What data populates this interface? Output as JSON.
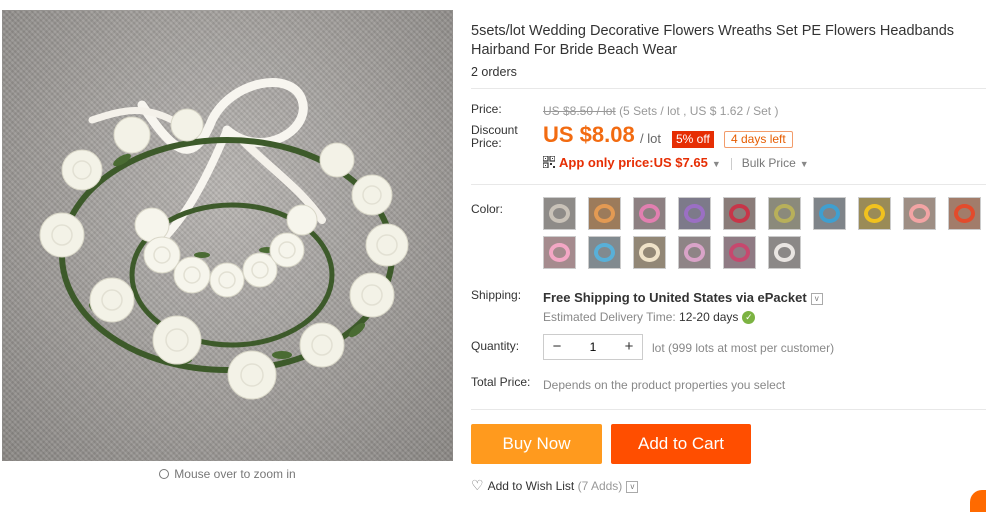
{
  "gallery": {
    "zoom_hint": "Mouse over to zoom in"
  },
  "product": {
    "title": "5sets/lot Wedding Decorative Flowers Wreaths Set PE Flowers Headbands Hairband For Bride Beach Wear",
    "orders": "2 orders"
  },
  "price": {
    "label": "Price:",
    "original": "US $8.50 / lot",
    "original_detail": "(5 Sets / lot , US $ 1.62 / Set )",
    "discount_label": "Discount Price:",
    "current": "US $8.08",
    "per_lot": "/ lot",
    "off_badge": "5% off",
    "days_left": "4 days left",
    "app_only": "App only price:US $7.65",
    "bulk_price": "Bulk Price"
  },
  "color": {
    "label": "Color:",
    "swatch_colors": [
      [
        "#8e8b88",
        "#c9c2b8"
      ],
      [
        "#9c7b5b",
        "#e39a53"
      ],
      [
        "#8d8082",
        "#e27fb0"
      ],
      [
        "#7d7a8a",
        "#9b6fc4"
      ],
      [
        "#8a7c79",
        "#c73548"
      ],
      [
        "#8b8a7b",
        "#b8b05a"
      ],
      [
        "#7f8489",
        "#3f9fd0"
      ],
      [
        "#9a8b57",
        "#f1c21e"
      ],
      [
        "#9e8e84",
        "#f3a4a4"
      ],
      [
        "#a27c6a",
        "#e34b2c"
      ],
      [
        "#a58b8e",
        "#f4a7c5"
      ],
      [
        "#818a8f",
        "#58b0d8"
      ],
      [
        "#928776",
        "#efe2c8"
      ],
      [
        "#8e8486",
        "#d9a3c8"
      ],
      [
        "#8f7b84",
        "#c6486e"
      ],
      [
        "#8b8887",
        "#e9e5e2"
      ]
    ]
  },
  "shipping": {
    "label": "Shipping:",
    "method": "Free Shipping to United States via ePacket",
    "estimate_label": "Estimated Delivery Time:",
    "estimate_days": "12-20 days"
  },
  "quantity": {
    "label": "Quantity:",
    "minus": "−",
    "plus": "+",
    "value": "1",
    "note": "lot (999 lots at most per customer)"
  },
  "total": {
    "label": "Total Price:",
    "value": "Depends on the product properties you select"
  },
  "actions": {
    "buy_now": "Buy Now",
    "add_to_cart": "Add to Cart",
    "wish_list": "Add to Wish List",
    "wish_adds": "(7 Adds)"
  }
}
